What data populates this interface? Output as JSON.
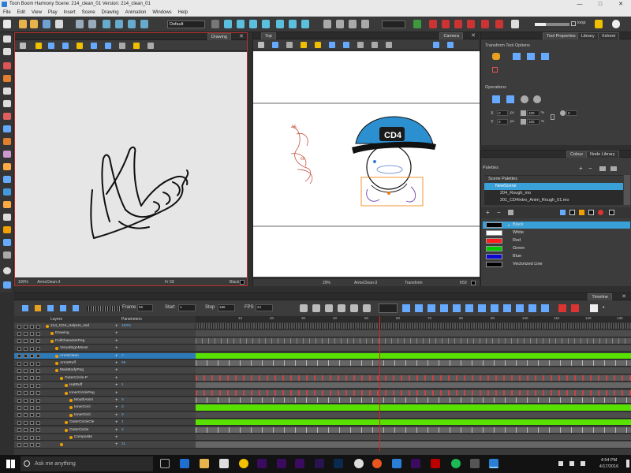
{
  "window": {
    "title": "Toon Boom Harmony Scene: 214_clean_01 Version: 214_clean_01",
    "controls": [
      "—",
      "□",
      "✕"
    ]
  },
  "menu": [
    "File",
    "Edit",
    "View",
    "Play",
    "Insert",
    "Scene",
    "Drawing",
    "Animation",
    "Windows",
    "Help"
  ],
  "toolbar": {
    "workspace": "Default",
    "loop_label": "loop"
  },
  "drawing_view": {
    "tab": "Drawing",
    "zoom": "100%",
    "layer": "ArmsClean-3",
    "frame": "Fr 59",
    "color_name": "Black"
  },
  "camera_view": {
    "top_tab": "Top",
    "tab": "Camera",
    "zoom": "29%",
    "layer": "ArmsClean-3",
    "mode": "Transform",
    "frame": "fr59",
    "hat_text": "CD4"
  },
  "tool_properties": {
    "tabs": [
      "Tool Properties",
      "Library",
      "Xsheet"
    ],
    "section1": "Transform Tool Options",
    "section2": "Operations",
    "fields": {
      "x": "0",
      "y": "0",
      "px1": "px",
      "px2": "px",
      "scale_x": "100",
      "scale_y": "100",
      "pct1": "%",
      "pct2": "%",
      "angle": "0"
    }
  },
  "colour_panel": {
    "tabs": [
      "Colour",
      "Node Library"
    ],
    "palettes_label": "Palettes",
    "scene_palettes": "Scene Palettes",
    "palettes": [
      "NewScene",
      "204_Rough_mo",
      "201_CD4Intro_Anim_Rough_01.mo"
    ],
    "colors": [
      {
        "name": "Black",
        "hex": "#000000"
      },
      {
        "name": "White",
        "hex": "#ffffff"
      },
      {
        "name": "Red",
        "hex": "#ff1e1e"
      },
      {
        "name": "Green",
        "hex": "#00c800"
      },
      {
        "name": "Blue",
        "hex": "#0a0ad2"
      },
      {
        "name": "Vectorized Line",
        "hex": "#000000"
      }
    ],
    "selected_highlight": "#3aa0d8"
  },
  "timeline": {
    "tab": "Timeline",
    "frame_label": "Frame",
    "frame_value": "59",
    "start_label": "Start",
    "start_value": "1",
    "stop_label": "Stop",
    "stop_value": "186",
    "fps_label": "FPS",
    "fps_value": "24",
    "header_layers": "Layers",
    "header_params": "Parameters",
    "ruler": [
      "10",
      "20",
      "30",
      "40",
      "50",
      "60",
      "70",
      "80",
      "90",
      "100",
      "110",
      "120",
      "130"
    ],
    "layers": [
      {
        "name": "214_CD4_HelpUs_snd",
        "param": "100%",
        "track": "sound",
        "indent": 0
      },
      {
        "name": "Drawing",
        "param": "",
        "track": "empty",
        "indent": 1
      },
      {
        "name": "FullCharacterPeg",
        "param": "",
        "track": "peg",
        "indent": 1
      },
      {
        "name": "VisualSignMover",
        "param": "",
        "track": "empty",
        "indent": 2
      },
      {
        "name": "ArmsClean",
        "param": "3",
        "track": "green",
        "indent": 2
      },
      {
        "name": "ArmsRuff",
        "param": "55",
        "track": "ticks",
        "indent": 2
      },
      {
        "name": "MainBodyPeg",
        "param": "",
        "track": "empty",
        "indent": 2
      },
      {
        "name": "OuterCircle-P",
        "param": "",
        "track": "keys",
        "indent": 3
      },
      {
        "name": "HatRuff",
        "param": "1",
        "track": "grey",
        "indent": 4
      },
      {
        "name": "InnerCirclePeg",
        "param": "",
        "track": "keys",
        "indent": 4
      },
      {
        "name": "MouthAnim",
        "param": "3",
        "track": "ticks",
        "indent": 5
      },
      {
        "name": "InnerCircl",
        "param": "3",
        "track": "green",
        "indent": 5
      },
      {
        "name": "InnerCircl",
        "param": "3",
        "track": "empty",
        "indent": 5
      },
      {
        "name": "OuterCircleCle",
        "param": "1",
        "track": "green",
        "indent": 4
      },
      {
        "name": "OuterCircle",
        "param": "2",
        "track": "ticks",
        "indent": 4
      },
      {
        "name": "Composite",
        "param": "",
        "track": "empty",
        "indent": 5
      },
      {
        "name": "",
        "param": "11",
        "track": "grey",
        "indent": 3
      }
    ]
  },
  "taskbar": {
    "search_placeholder": "Ask me anything",
    "time": "4:54 PM",
    "date": "4/17/2016"
  }
}
